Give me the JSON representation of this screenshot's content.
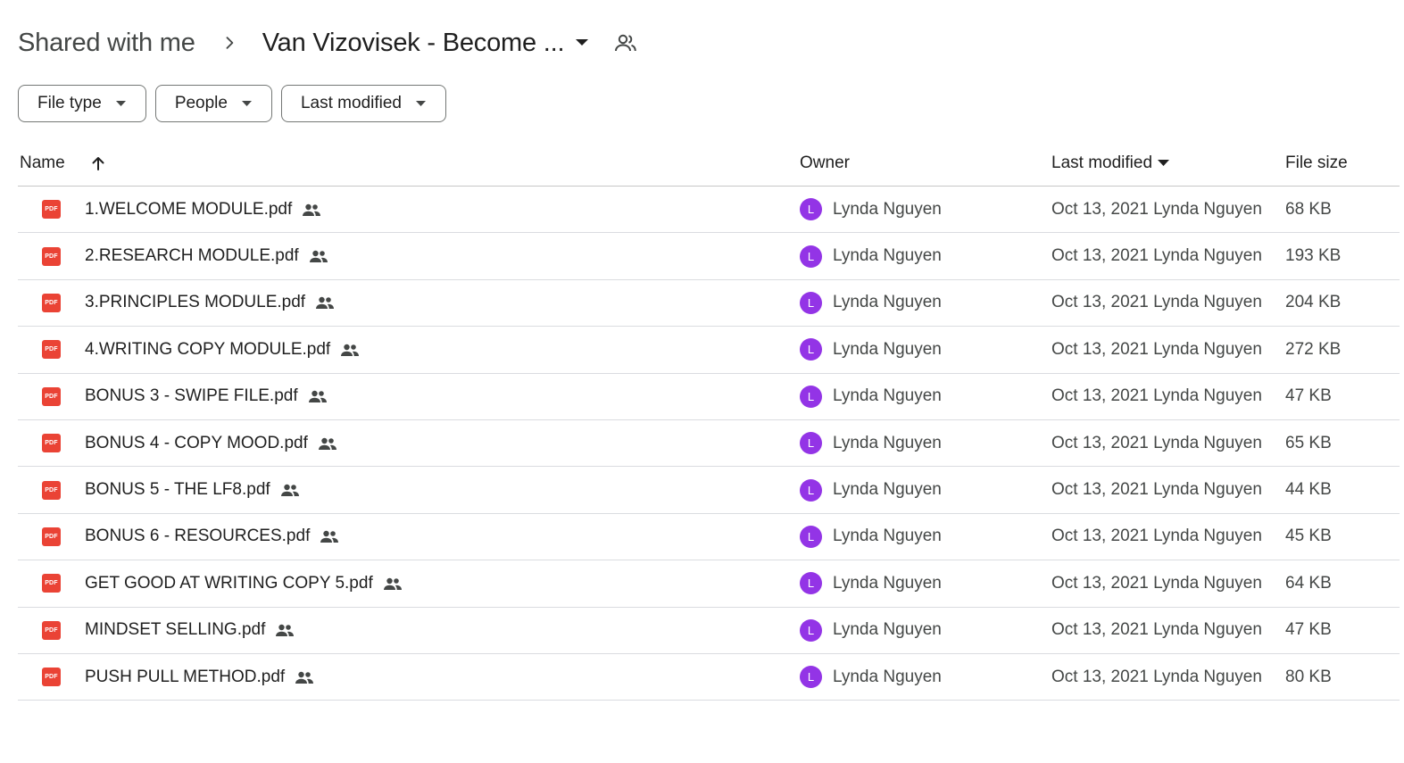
{
  "breadcrumb": {
    "root": "Shared with me",
    "current": "Van Vizovisek - Become ..."
  },
  "filters": [
    "File type",
    "People",
    "Last modified"
  ],
  "columns": {
    "name": "Name",
    "owner": "Owner",
    "last_modified": "Last modified",
    "file_size": "File size"
  },
  "colors": {
    "pdf": "#ea4335",
    "avatar": "#9334e6"
  },
  "files": [
    {
      "name": "1.WELCOME MODULE.pdf",
      "owner": "Lynda Nguyen",
      "avatar": "L",
      "modified": "Oct 13, 2021 Lynda Nguyen",
      "size": "68 KB"
    },
    {
      "name": "2.RESEARCH MODULE.pdf",
      "owner": "Lynda Nguyen",
      "avatar": "L",
      "modified": "Oct 13, 2021 Lynda Nguyen",
      "size": "193 KB"
    },
    {
      "name": "3.PRINCIPLES MODULE.pdf",
      "owner": "Lynda Nguyen",
      "avatar": "L",
      "modified": "Oct 13, 2021 Lynda Nguyen",
      "size": "204 KB"
    },
    {
      "name": "4.WRITING COPY MODULE.pdf",
      "owner": "Lynda Nguyen",
      "avatar": "L",
      "modified": "Oct 13, 2021 Lynda Nguyen",
      "size": "272 KB"
    },
    {
      "name": "BONUS 3 - SWIPE FILE.pdf",
      "owner": "Lynda Nguyen",
      "avatar": "L",
      "modified": "Oct 13, 2021 Lynda Nguyen",
      "size": "47 KB"
    },
    {
      "name": "BONUS 4 - COPY MOOD.pdf",
      "owner": "Lynda Nguyen",
      "avatar": "L",
      "modified": "Oct 13, 2021 Lynda Nguyen",
      "size": "65 KB"
    },
    {
      "name": "BONUS 5 - THE LF8.pdf",
      "owner": "Lynda Nguyen",
      "avatar": "L",
      "modified": "Oct 13, 2021 Lynda Nguyen",
      "size": "44 KB"
    },
    {
      "name": "BONUS 6 - RESOURCES.pdf",
      "owner": "Lynda Nguyen",
      "avatar": "L",
      "modified": "Oct 13, 2021 Lynda Nguyen",
      "size": "45 KB"
    },
    {
      "name": "GET GOOD AT WRITING COPY 5.pdf",
      "owner": "Lynda Nguyen",
      "avatar": "L",
      "modified": "Oct 13, 2021 Lynda Nguyen",
      "size": "64 KB"
    },
    {
      "name": "MINDSET SELLING.pdf",
      "owner": "Lynda Nguyen",
      "avatar": "L",
      "modified": "Oct 13, 2021 Lynda Nguyen",
      "size": "47 KB"
    },
    {
      "name": "PUSH PULL METHOD.pdf",
      "owner": "Lynda Nguyen",
      "avatar": "L",
      "modified": "Oct 13, 2021 Lynda Nguyen",
      "size": "80 KB"
    }
  ]
}
